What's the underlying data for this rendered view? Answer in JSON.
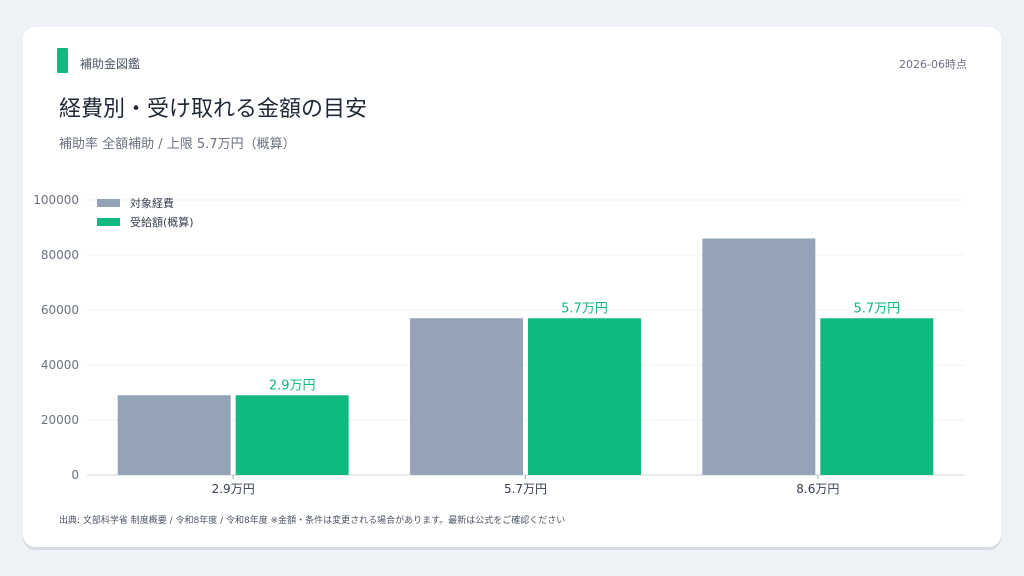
{
  "header": {
    "brand": "補助金図鑑",
    "date": "2026-06時点",
    "title": "経費別・受け取れる金額の目安",
    "subtitle": "補助率 全額補助 / 上限 5.7万円（概算）"
  },
  "footnote": "出典: 文部科学省 制度概要 / 令和8年度 / 令和8年度 ※金額・条件は変更される場合があります。最新は公式をご確認ください",
  "colors": {
    "eligible": "#94a3b8",
    "received": "#10b981",
    "accent": "#10b981"
  },
  "chart_data": {
    "type": "bar",
    "categories": [
      "2.9万円",
      "5.7万円",
      "8.6万円"
    ],
    "series": [
      {
        "name": "対象経費",
        "values": [
          29000,
          57000,
          86000
        ]
      },
      {
        "name": "受給額(概算)",
        "values": [
          29000,
          57000,
          57000
        ],
        "labels": [
          "2.9万円",
          "5.7万円",
          "5.7万円"
        ]
      }
    ],
    "yticks": [
      "0",
      "20000",
      "40000",
      "60000",
      "80000",
      "100000"
    ],
    "ylim": [
      0,
      100000
    ],
    "legend": "top-left",
    "grid": true
  }
}
